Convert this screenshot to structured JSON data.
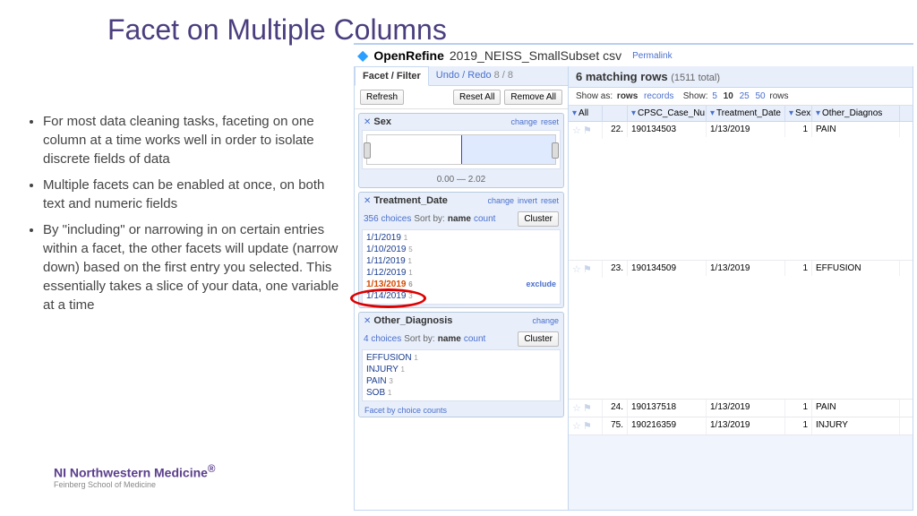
{
  "slide": {
    "title": "Facet on Multiple Columns",
    "bullets": [
      "For most data cleaning tasks, faceting on one column at a time works well in order to isolate discrete fields of data",
      "Multiple facets can be enabled at once, on both text and numeric fields",
      "By \"including\" or narrowing in on certain entries within a facet, the other facets will update (narrow down) based on the first entry you selected. This essentially takes a slice of your data, one variable at a time"
    ],
    "logo_main": "Northwestern Medicine",
    "logo_sub": "Feinberg School of Medicine"
  },
  "app": {
    "name": "OpenRefine",
    "project": "2019_NEISS_SmallSubset csv",
    "permalink": "Permalink",
    "tabs": {
      "facet": "Facet / Filter",
      "undo": "Undo / Redo",
      "undo_count": "8 / 8"
    },
    "toolbar": {
      "refresh": "Refresh",
      "reset_all": "Reset All",
      "remove_all": "Remove All"
    }
  },
  "facets": {
    "sex": {
      "title": "Sex",
      "change": "change",
      "reset": "reset",
      "range": "0.00 — 2.02"
    },
    "td": {
      "title": "Treatment_Date",
      "change": "change",
      "invert": "invert",
      "reset": "reset",
      "count": "356 choices",
      "sortby": "Sort by:",
      "name": "name",
      "countl": "count",
      "cluster": "Cluster",
      "rows": [
        {
          "v": "1/1/2019",
          "c": "1"
        },
        {
          "v": "1/10/2019",
          "c": "5"
        },
        {
          "v": "1/11/2019",
          "c": "1"
        },
        {
          "v": "1/12/2019",
          "c": "1"
        },
        {
          "v": "1/13/2019",
          "c": "6",
          "sel": true,
          "excl": "exclude"
        },
        {
          "v": "1/14/2019",
          "c": "3"
        }
      ]
    },
    "od": {
      "title": "Other_Diagnosis",
      "change": "change",
      "count": "4 choices",
      "sortby": "Sort by:",
      "name": "name",
      "countl": "count",
      "cluster": "Cluster",
      "rows": [
        {
          "v": "EFFUSION",
          "c": "1"
        },
        {
          "v": "INJURY",
          "c": "1"
        },
        {
          "v": "PAIN",
          "c": "3"
        },
        {
          "v": "SOB",
          "c": "1"
        }
      ],
      "fbc": "Facet by choice counts"
    }
  },
  "results": {
    "heading": "6 matching rows",
    "total": "(1511 total)",
    "show_as": "Show as:",
    "rows": "rows",
    "records": "records",
    "show": "Show:",
    "opts": [
      "5",
      "10",
      "25",
      "50"
    ],
    "sel": "10",
    "unit": "rows",
    "cols": [
      "All",
      "CPSC_Case_Nu",
      "Treatment_Date",
      "Sex",
      "Other_Diagnos"
    ],
    "data": [
      {
        "n": "22.",
        "case": "190134503",
        "date": "1/13/2019",
        "sex": "1",
        "diag": "PAIN",
        "tall": true
      },
      {
        "n": "23.",
        "case": "190134509",
        "date": "1/13/2019",
        "sex": "1",
        "diag": "EFFUSION",
        "tall": true
      },
      {
        "n": "24.",
        "case": "190137518",
        "date": "1/13/2019",
        "sex": "1",
        "diag": "PAIN"
      },
      {
        "n": "75.",
        "case": "190216359",
        "date": "1/13/2019",
        "sex": "1",
        "diag": "INJURY"
      }
    ]
  }
}
